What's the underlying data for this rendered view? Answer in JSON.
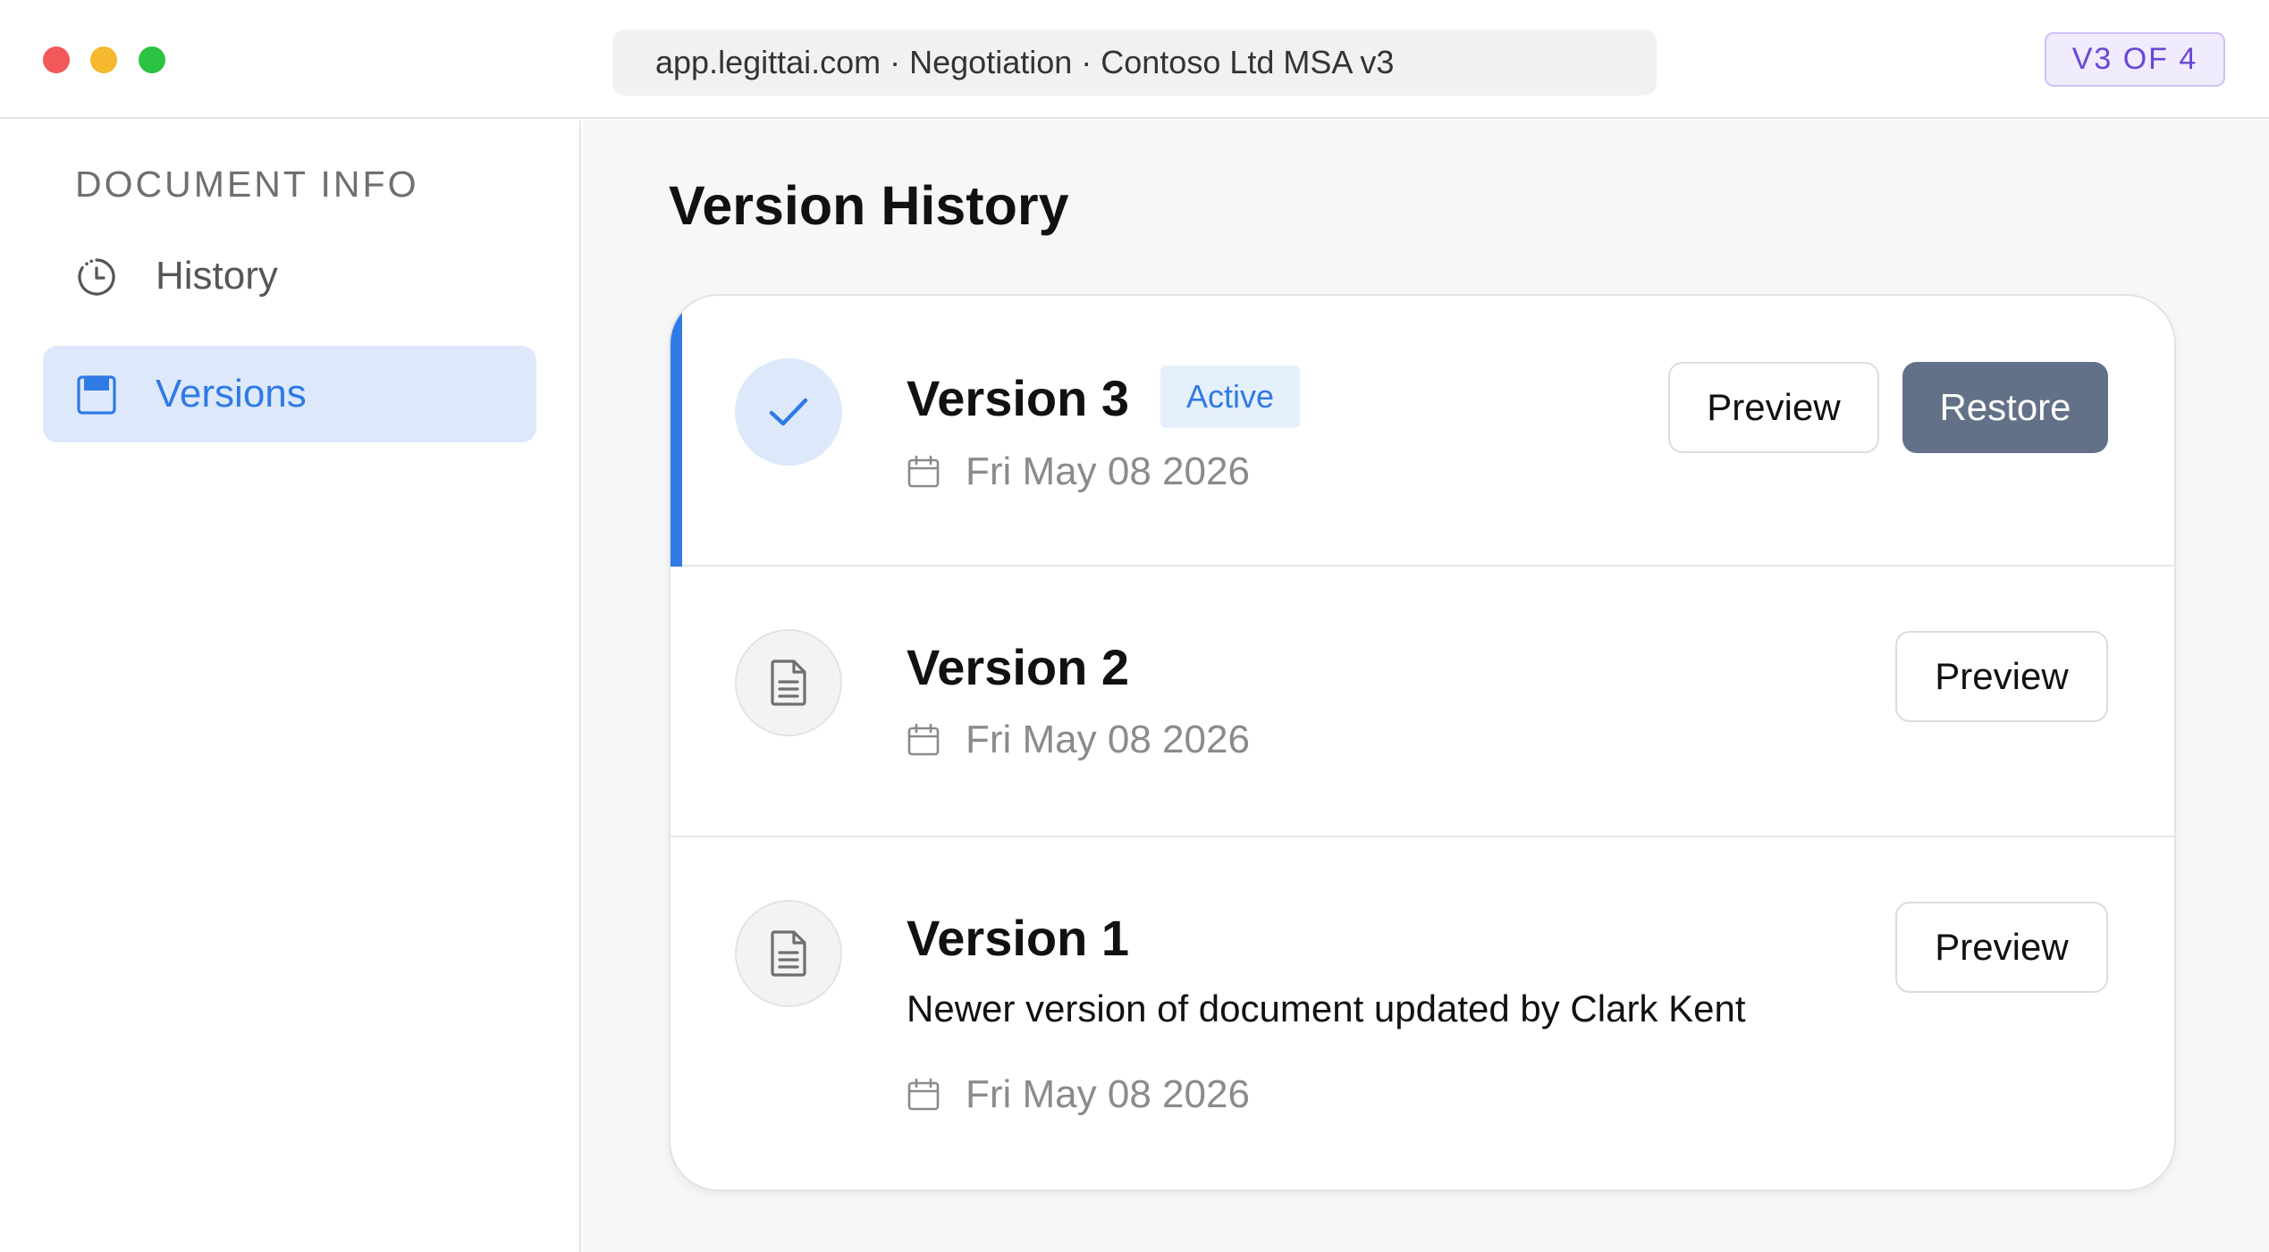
{
  "window": {
    "url_text": "app.legittai.com · Negotiation · Contoso Ltd MSA v3",
    "version_badge": "V3 OF 4"
  },
  "sidebar": {
    "heading": "DOCUMENT INFO",
    "items": [
      {
        "label": "History",
        "icon": "clock-history-icon",
        "selected": false
      },
      {
        "label": "Versions",
        "icon": "save-disk-icon",
        "selected": true
      }
    ]
  },
  "main": {
    "title": "Version History",
    "versions": [
      {
        "name": "Version 3",
        "badge": "Active",
        "date": "Fri May 08 2026",
        "icon": "check-icon",
        "preview_label": "Preview",
        "restore_label": "Restore"
      },
      {
        "name": "Version 2",
        "date": "Fri May 08 2026",
        "icon": "document-icon",
        "preview_label": "Preview"
      },
      {
        "name": "Version 1",
        "description": "Newer version of document updated by Clark Kent",
        "date": "Fri May 08 2026",
        "icon": "document-icon",
        "preview_label": "Preview"
      }
    ]
  },
  "colors": {
    "accent": "#2f7ae5",
    "active_bg": "#dde9fb",
    "restore_button": "#627188",
    "version_badge_text": "#6a46d6"
  }
}
